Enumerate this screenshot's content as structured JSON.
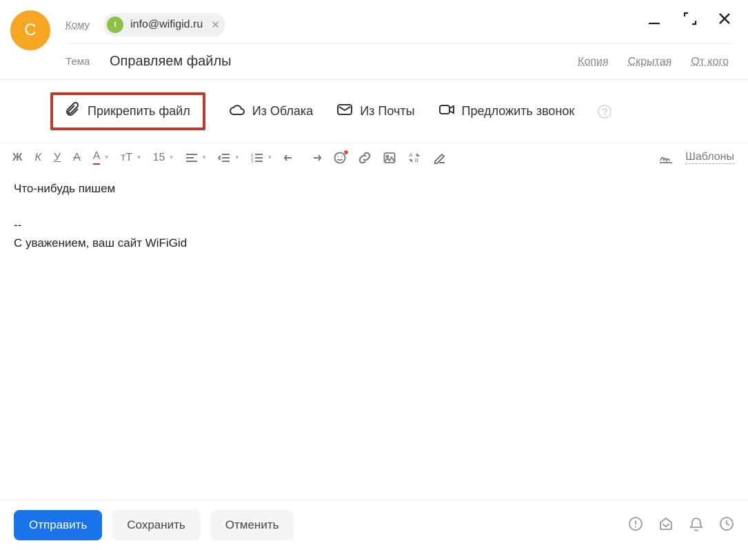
{
  "header": {
    "avatar_initial": "С",
    "to_label": "Кому",
    "recipient_chip": {
      "initial": "I",
      "email": "info@wifigid.ru"
    },
    "subject_label": "Тема",
    "subject_value": "Оправляем файлы",
    "links": {
      "cc": "Копия",
      "bcc": "Скрытая",
      "from": "От кого"
    }
  },
  "attach": {
    "file": "Прикрепить файл",
    "cloud": "Из Облака",
    "mail": "Из Почты",
    "call": "Предложить звонок"
  },
  "toolbar": {
    "font_size": "15",
    "templates": "Шаблоны"
  },
  "body": {
    "line1": "Что-нибудь пишем",
    "sig_sep": "--",
    "sig": "С уважением, ваш сайт WiFiGid"
  },
  "footer": {
    "send": "Отправить",
    "save": "Сохранить",
    "cancel": "Отменить"
  }
}
